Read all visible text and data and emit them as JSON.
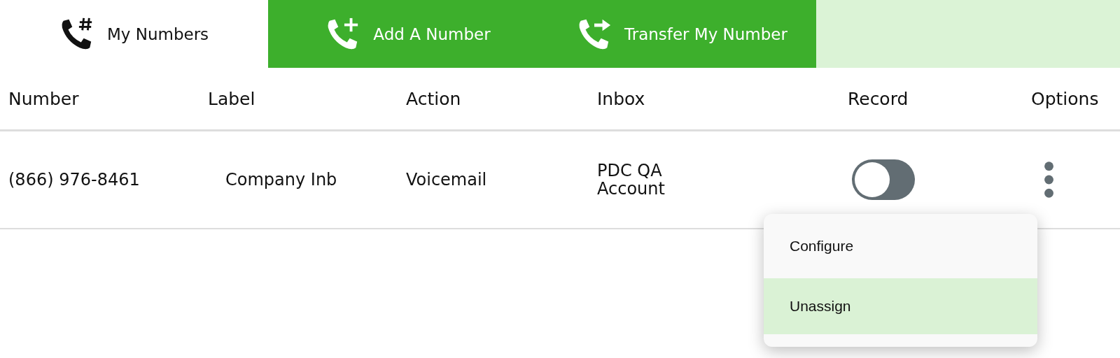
{
  "tabs": [
    {
      "label": "My Numbers",
      "kind": "hash",
      "selected": true
    },
    {
      "label": "Add A Number",
      "kind": "plus",
      "selected": false
    },
    {
      "label": "Transfer My Number",
      "kind": "arrow",
      "selected": false
    }
  ],
  "table": {
    "columns": [
      "Number",
      "Label",
      "Action",
      "Inbox",
      "Record",
      "Options"
    ],
    "rows": [
      {
        "number": "(866) 976-8461",
        "label": "Company Inb",
        "action": "Voicemail",
        "inbox": "PDC QA Account",
        "record_on": false
      }
    ]
  },
  "menu": {
    "items": [
      {
        "label": "Configure",
        "selected": false
      },
      {
        "label": "Unassign",
        "selected": true
      }
    ]
  }
}
